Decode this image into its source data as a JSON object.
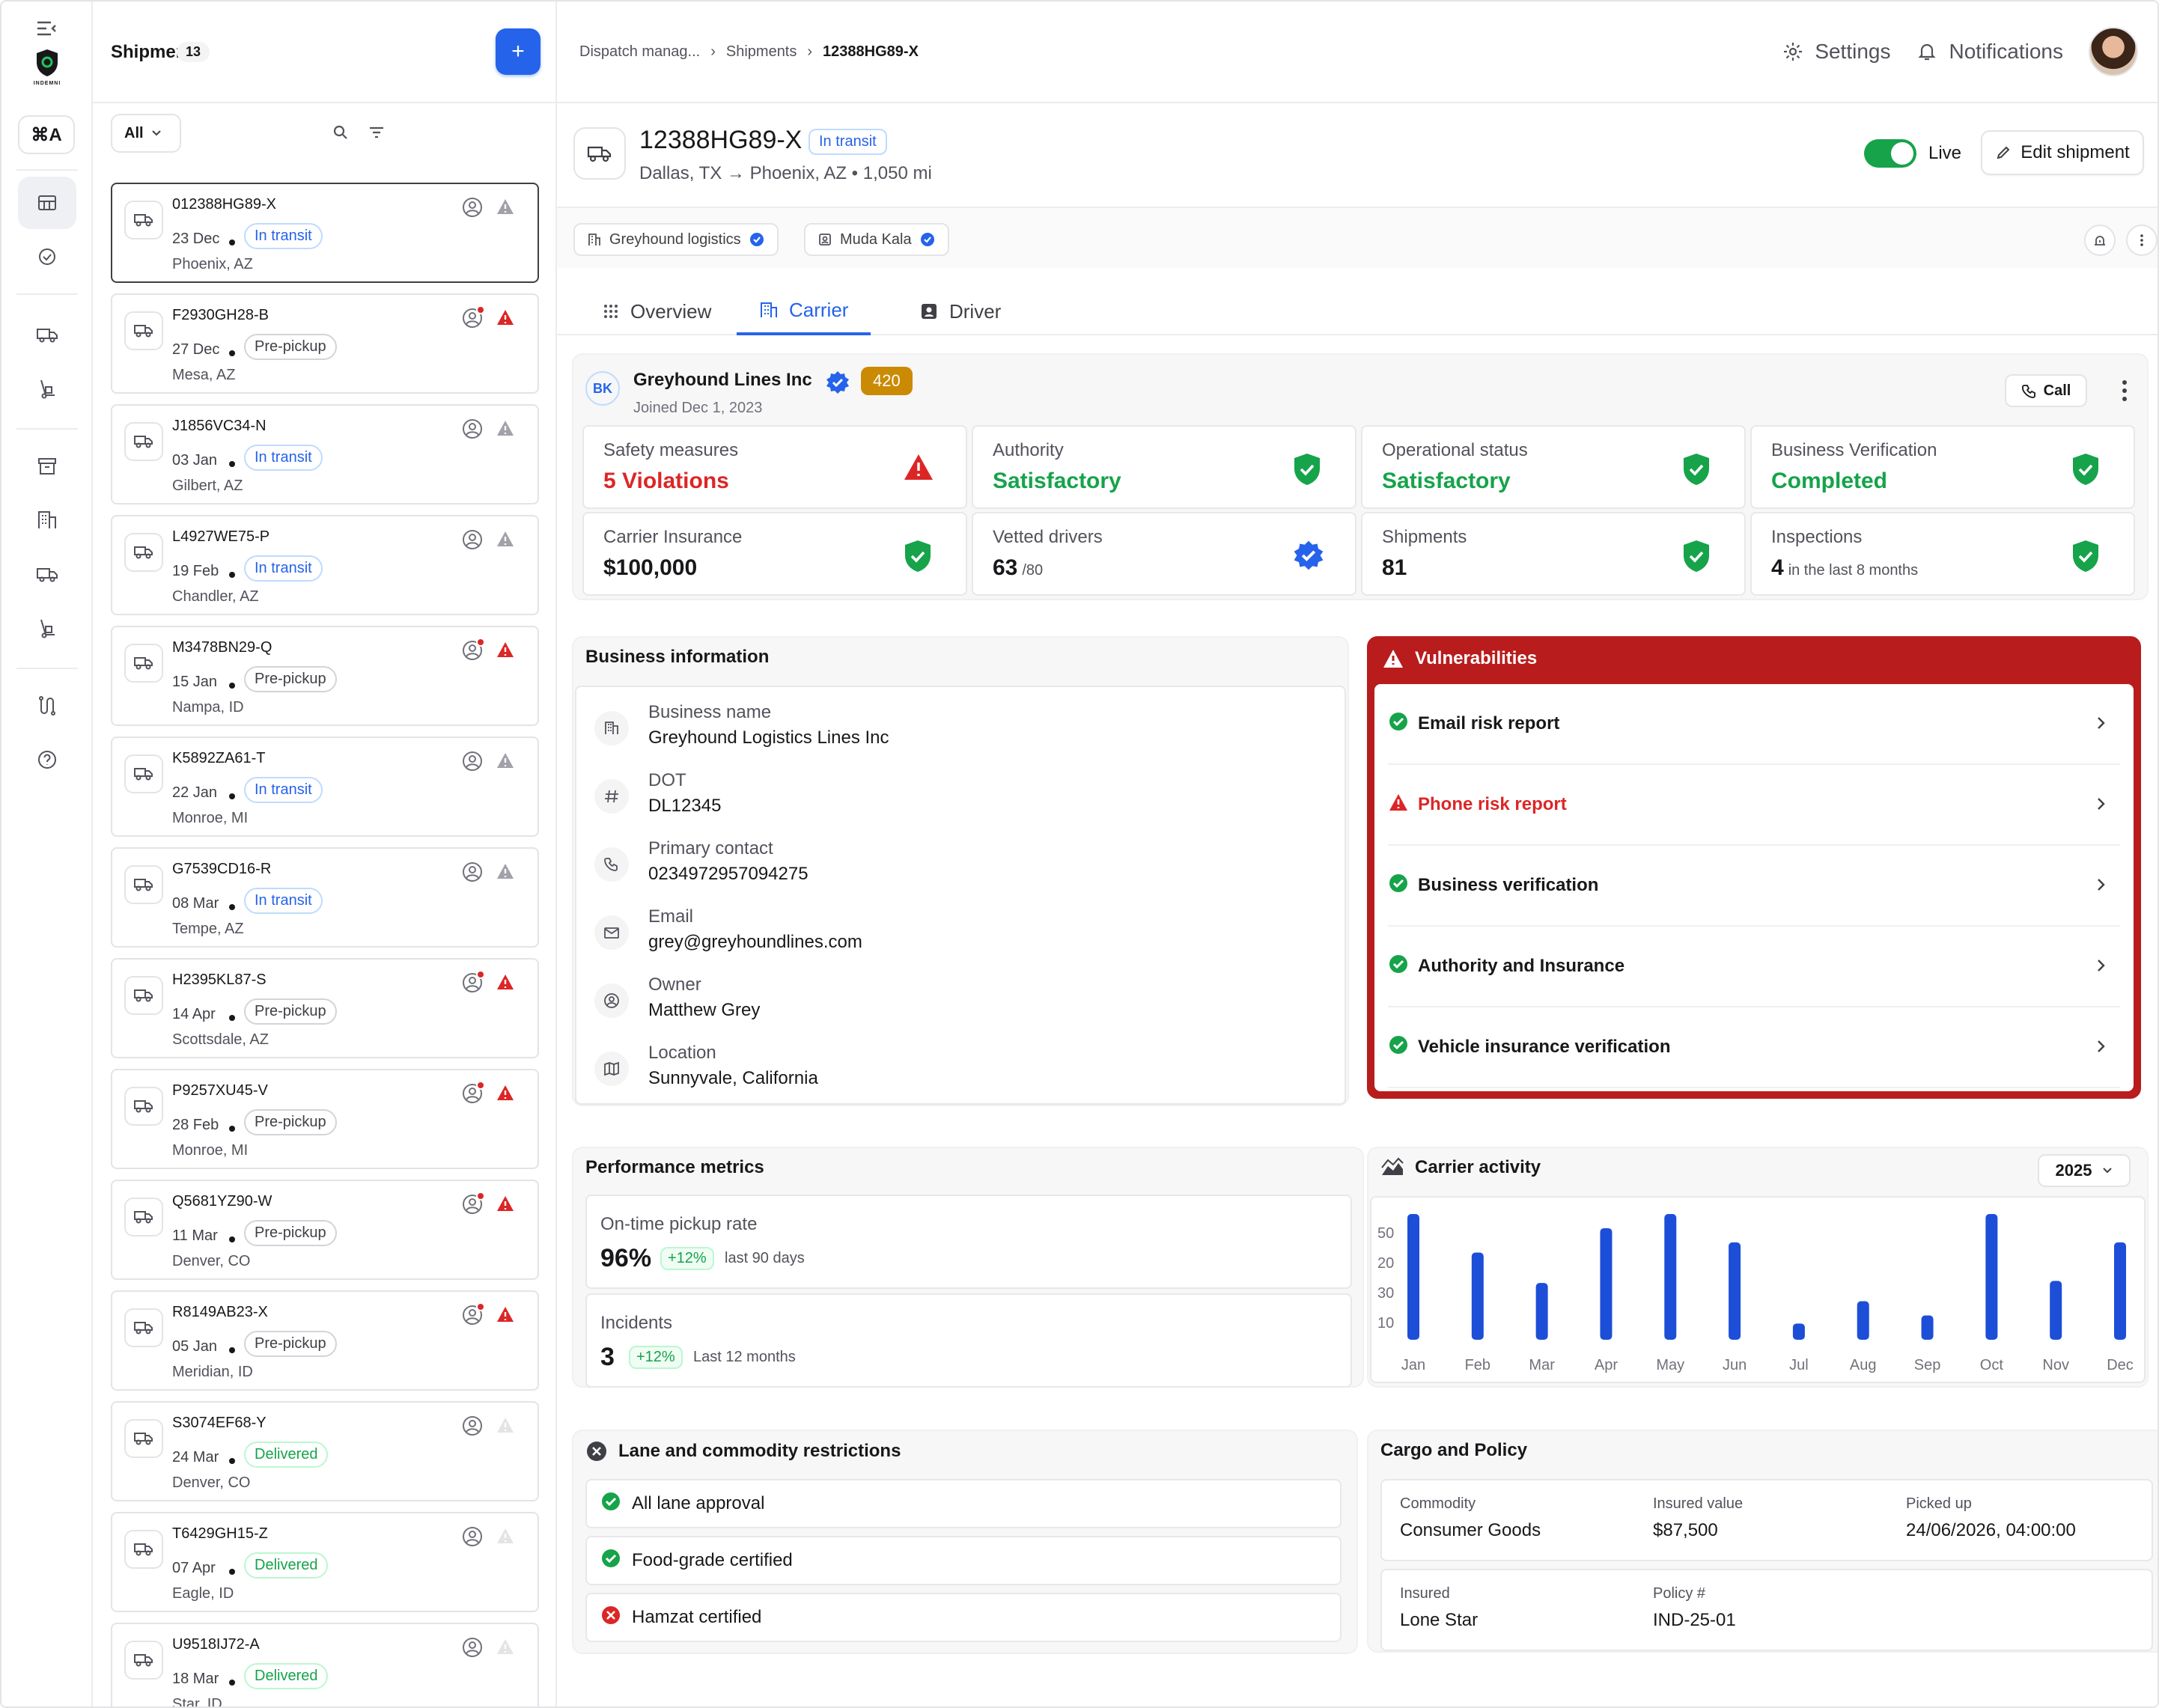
{
  "app": {
    "logo_text": "INDEMNI",
    "shortcut": "⌘A"
  },
  "list": {
    "title": "Shipments",
    "count": "13",
    "filter": "All",
    "items": [
      {
        "id": "012388HG89-X",
        "date": "23 Dec",
        "status": "In transit",
        "location": "Phoenix, AZ"
      },
      {
        "id": "F2930GH28-B",
        "date": "27 Dec",
        "status": "Pre-pickup",
        "location": "Mesa, AZ"
      },
      {
        "id": "J1856VC34-N",
        "date": "03 Jan",
        "status": "In transit",
        "location": "Gilbert, AZ"
      },
      {
        "id": "L4927WE75-P",
        "date": "19 Feb",
        "status": "In transit",
        "location": "Chandler, AZ"
      },
      {
        "id": "M3478BN29-Q",
        "date": "15 Jan",
        "status": "Pre-pickup",
        "location": "Nampa, ID"
      },
      {
        "id": "K5892ZA61-T",
        "date": "22 Jan",
        "status": "In transit",
        "location": "Monroe, MI"
      },
      {
        "id": "G7539CD16-R",
        "date": "08 Mar",
        "status": "In transit",
        "location": "Tempe, AZ"
      },
      {
        "id": "H2395KL87-S",
        "date": "14 Apr",
        "status": "Pre-pickup",
        "location": "Scottsdale, AZ"
      },
      {
        "id": "P9257XU45-V",
        "date": "28 Feb",
        "status": "Pre-pickup",
        "location": "Monroe, MI"
      },
      {
        "id": "Q5681YZ90-W",
        "date": "11 Mar",
        "status": "Pre-pickup",
        "location": "Denver, CO"
      },
      {
        "id": "R8149AB23-X",
        "date": "05 Jan",
        "status": "Pre-pickup",
        "location": "Meridian, ID"
      },
      {
        "id": "S3074EF68-Y",
        "date": "24 Mar",
        "status": "Delivered",
        "location": "Denver, CO"
      },
      {
        "id": "T6429GH15-Z",
        "date": "07 Apr",
        "status": "Delivered",
        "location": "Eagle, ID"
      },
      {
        "id": "U9518IJ72-A",
        "date": "18 Mar",
        "status": "Delivered",
        "location": "Star, ID"
      }
    ]
  },
  "topbar": {
    "breadcrumb": [
      "Dispatch manag...",
      "Shipments",
      "12388HG89-X"
    ],
    "settings": "Settings",
    "notifications": "Notifications"
  },
  "shipment": {
    "id": "12388HG89-X",
    "status": "In transit",
    "route": "Dallas, TX → Phoenix, AZ • 1,050 mi",
    "live_label": "Live",
    "edit_label": "Edit shipment",
    "chip_company": "Greyhound logistics",
    "chip_driver": "Muda Kala"
  },
  "tabs": [
    "Overview",
    "Carrier",
    "Driver"
  ],
  "carrier": {
    "initials": "BK",
    "name": "Greyhound Lines Inc",
    "score": "420",
    "joined": "Joined Dec 1, 2023",
    "call": "Call"
  },
  "stats": [
    {
      "label": "Safety measures",
      "value": "5 Violations",
      "suffix": "",
      "color": "#dc2626",
      "icon": "warning-icon"
    },
    {
      "label": "Authority",
      "value": "Satisfactory",
      "suffix": "",
      "color": "#16a34a",
      "icon": "shield-check-icon"
    },
    {
      "label": "Operational status",
      "value": "Satisfactory",
      "suffix": "",
      "color": "#16a34a",
      "icon": "shield-check-icon"
    },
    {
      "label": "Business Verification",
      "value": "Completed",
      "suffix": "",
      "color": "#16a34a",
      "icon": "shield-check-icon"
    },
    {
      "label": "Carrier Insurance",
      "value": "$100,000",
      "suffix": "",
      "color": "#18181b",
      "icon": "shield-check-icon"
    },
    {
      "label": "Vetted drivers",
      "value": "63",
      "suffix": "/80",
      "color": "#18181b",
      "icon": "verified-badge-icon"
    },
    {
      "label": "Shipments",
      "value": "81",
      "suffix": "",
      "color": "#18181b",
      "icon": "shield-check-icon"
    },
    {
      "label": "Inspections",
      "value": "4",
      "suffix": "in the last 8 months",
      "color": "#18181b",
      "icon": "shield-check-icon"
    }
  ],
  "business": {
    "title": "Business information",
    "fields": [
      {
        "label": "Business name",
        "value": "Greyhound Logistics Lines Inc",
        "icon": "building-icon"
      },
      {
        "label": "DOT",
        "value": "DL12345",
        "icon": "hash-icon"
      },
      {
        "label": "Primary contact",
        "value": "0234972957094275",
        "icon": "phone-icon"
      },
      {
        "label": "Email",
        "value": "grey@greyhoundlines.com",
        "icon": "mail-icon"
      },
      {
        "label": "Owner",
        "value": "Matthew Grey",
        "icon": "user-icon"
      },
      {
        "label": "Location",
        "value": "Sunnyvale, California",
        "icon": "map-icon"
      }
    ]
  },
  "vulnerabilities": {
    "title": "Vulnerabilities",
    "items": [
      {
        "label": "Email risk report",
        "state": "ok"
      },
      {
        "label": "Phone risk report",
        "state": "warn"
      },
      {
        "label": "Business verification",
        "state": "ok"
      },
      {
        "label": "Authority and Insurance",
        "state": "ok"
      },
      {
        "label": "Vehicle insurance verification",
        "state": "ok"
      }
    ]
  },
  "performance": {
    "title": "Performance metrics",
    "items": [
      {
        "label": "On-time pickup rate",
        "value": "96%",
        "change": "+12%",
        "period": "last 90 days"
      },
      {
        "label": "Incidents",
        "value": "3",
        "change": "+12%",
        "period": "Last 12 months"
      }
    ]
  },
  "activity": {
    "title": "Carrier activity",
    "year": "2025"
  },
  "chart_data": {
    "type": "bar",
    "categories": [
      "Jan",
      "Feb",
      "Mar",
      "Apr",
      "May",
      "Jun",
      "Jul",
      "Aug",
      "Sep",
      "Oct",
      "Nov",
      "Dec"
    ],
    "values": [
      62,
      43,
      28,
      55,
      62,
      48,
      8,
      19,
      12,
      62,
      29,
      48
    ],
    "ytick_labels": [
      "50",
      "20",
      "30",
      "10"
    ],
    "ylim": [
      0,
      62
    ],
    "grid": false,
    "color": "#1d4ed8"
  },
  "lanes": {
    "title": "Lane and commodity restrictions",
    "items": [
      {
        "label": "All lane approval",
        "state": "ok"
      },
      {
        "label": "Food-grade certified",
        "state": "ok"
      },
      {
        "label": "Hamzat certified",
        "state": "fail"
      }
    ]
  },
  "cargo": {
    "title": "Cargo and Policy",
    "rows": [
      [
        {
          "label": "Commodity",
          "value": "Consumer Goods"
        },
        {
          "label": "Insured value",
          "value": "$87,500"
        },
        {
          "label": "Picked up",
          "value": "24/06/2026, 04:00:00"
        }
      ],
      [
        {
          "label": "Insured",
          "value": "Lone Star"
        },
        {
          "label": "Policy #",
          "value": "IND-25-01"
        }
      ]
    ]
  },
  "colors": {
    "accent": "#2563eb",
    "success": "#16a34a",
    "danger": "#dc2626",
    "vulnerability_bg": "#b91c1c"
  }
}
